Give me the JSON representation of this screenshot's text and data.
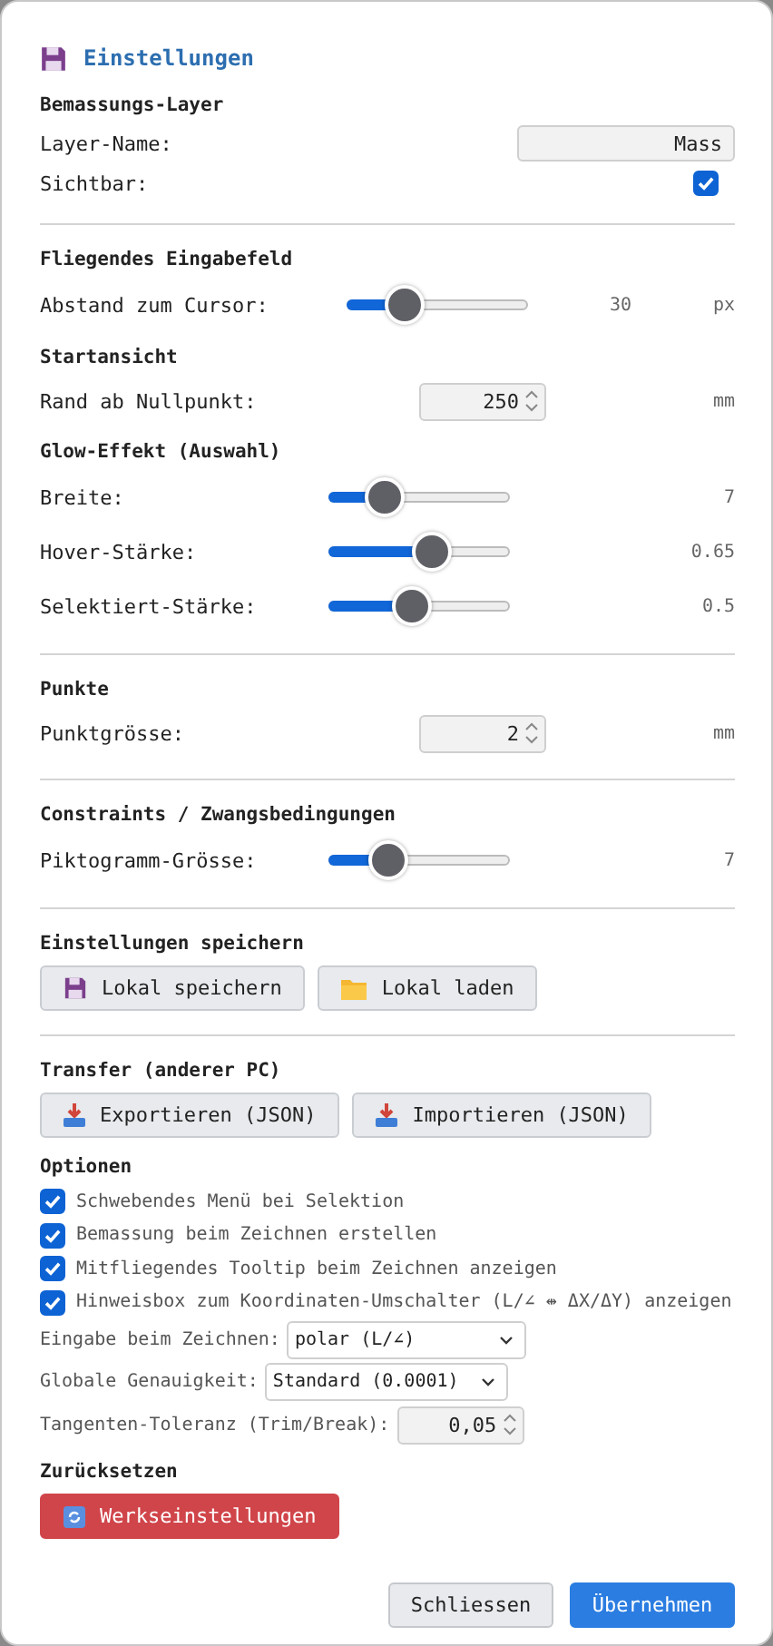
{
  "dialog": {
    "title": "Einstellungen"
  },
  "groups": [
    {
      "sections": [
        {
          "heading": "Bemassungs-Layer",
          "rows": [
            {
              "kind": "text",
              "label": "Layer-Name:",
              "value": "Mass"
            },
            {
              "kind": "checkbox",
              "label": "Sichtbar:",
              "checked": true
            }
          ]
        }
      ]
    },
    {
      "sections": [
        {
          "heading": "Fliegendes Eingabefeld",
          "rows": [
            {
              "kind": "slider",
              "label": "Abstand zum Cursor:",
              "level": 0.27,
              "reading": "30",
              "unit": "px"
            }
          ]
        },
        {
          "heading": "Startansicht",
          "rows": [
            {
              "kind": "number",
              "label": "Rand ab Nullpunkt:",
              "value": "250",
              "unit": "mm"
            }
          ]
        },
        {
          "heading": "Glow-Effekt (Auswahl)",
          "rows": [
            {
              "kind": "slider",
              "label": "Breite:",
              "level": 0.25,
              "reading": "7"
            },
            {
              "kind": "slider",
              "label": "Hover-Stärke:",
              "level": 0.59,
              "reading": "0.65"
            },
            {
              "kind": "slider",
              "label": "Selektiert-Stärke:",
              "level": 0.45,
              "reading": "0.5"
            }
          ]
        }
      ]
    },
    {
      "sections": [
        {
          "heading": "Punkte",
          "rows": [
            {
              "kind": "number",
              "label": "Punktgrösse:",
              "value": "2",
              "unit": "mm"
            }
          ]
        }
      ]
    },
    {
      "sections": [
        {
          "heading": "Constraints / Zwangsbedingungen",
          "rows": [
            {
              "kind": "slider",
              "label": "Piktogramm-Grösse:",
              "level": 0.28,
              "reading": "7"
            }
          ]
        }
      ]
    },
    {
      "sections": [
        {
          "heading": "Einstellungen speichern",
          "rows": [
            {
              "kind": "buttons",
              "buttons": [
                {
                  "kind": "save",
                  "label": "Lokal speichern"
                },
                {
                  "kind": "load",
                  "label": "Lokal laden"
                }
              ]
            }
          ]
        }
      ]
    },
    {
      "sections": [
        {
          "heading": "Transfer (anderer PC)",
          "rows": [
            {
              "kind": "buttons",
              "buttons": [
                {
                  "kind": "export",
                  "label": "Exportieren (JSON)"
                },
                {
                  "kind": "import",
                  "label": "Importieren (JSON)"
                }
              ]
            }
          ]
        },
        {
          "heading": "Optionen",
          "rows": [
            {
              "kind": "option",
              "label": "Schwebendes Menü bei Selektion",
              "checked": true
            },
            {
              "kind": "option",
              "label": "Bemassung beim Zeichnen erstellen",
              "checked": true
            },
            {
              "kind": "option",
              "label": "Mitfliegendes Tooltip beim Zeichnen anzeigen",
              "checked": true
            },
            {
              "kind": "option",
              "label": "Hinweisbox zum Koordinaten-Umschalter (L/∠ ⇹ ΔX/ΔY) anzeigen",
              "checked": true
            },
            {
              "kind": "select",
              "label": "Eingabe beim Zeichnen:",
              "value": "polar (L/∠)"
            },
            {
              "kind": "select",
              "label": "Globale Genauigkeit:",
              "value": "Standard (0.0001)"
            },
            {
              "kind": "spin",
              "label": "Tangenten-Toleranz (Trim/Break):",
              "value": "0,05"
            }
          ]
        },
        {
          "heading": "Zurücksetzen",
          "rows": [
            {
              "kind": "buttons",
              "buttons": [
                {
                  "kind": "reset",
                  "label": "Werkseinstellungen"
                }
              ]
            }
          ]
        }
      ]
    }
  ],
  "footer": [
    {
      "label": "Schliessen",
      "primary": false
    },
    {
      "label": "Übernehmen",
      "primary": true
    }
  ]
}
